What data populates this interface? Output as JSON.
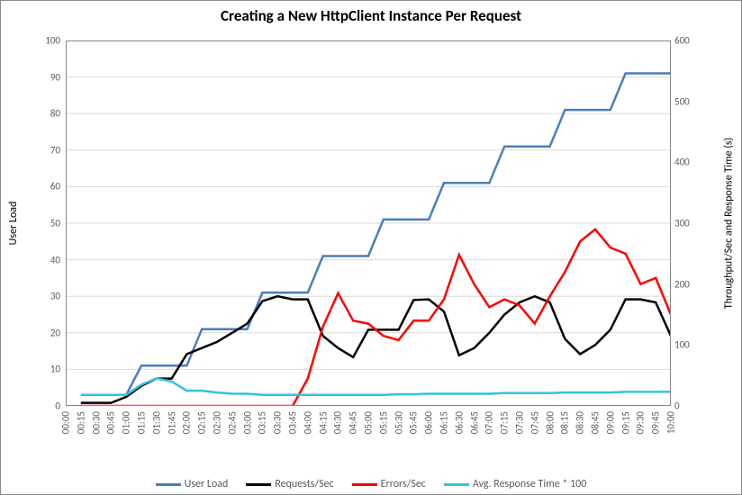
{
  "chart_data": {
    "type": "line",
    "title": "Creating a New HttpClient Instance Per Request",
    "x_categories": [
      "00:00",
      "00:15",
      "00:30",
      "00:45",
      "01:00",
      "01:15",
      "01:30",
      "01:45",
      "02:00",
      "02:15",
      "02:30",
      "02:45",
      "03:00",
      "03:15",
      "03:30",
      "03:45",
      "04:00",
      "04:15",
      "04:30",
      "04:45",
      "05:00",
      "05:15",
      "05:30",
      "05:45",
      "06:00",
      "06:15",
      "06:30",
      "06:45",
      "07:00",
      "07:15",
      "07:30",
      "07:45",
      "08:00",
      "08:15",
      "08:30",
      "08:45",
      "09:00",
      "09:15",
      "09:30",
      "09:45",
      "10:00"
    ],
    "y1": {
      "label": "User Load",
      "min": 0,
      "max": 100,
      "ticks": [
        0,
        10,
        20,
        30,
        40,
        50,
        60,
        70,
        80,
        90,
        100
      ]
    },
    "y2": {
      "label": "Throughput/Sec and Response Time (s)",
      "min": 0,
      "max": 600,
      "ticks": [
        0,
        100,
        200,
        300,
        400,
        500,
        600
      ]
    },
    "series": [
      {
        "name": "User  Load",
        "color": "#4a7ebb",
        "axis": "y1",
        "values": [
          null,
          3,
          3,
          3,
          3,
          11,
          11,
          11,
          11,
          21,
          21,
          21,
          21,
          31,
          31,
          31,
          31,
          41,
          41,
          41,
          41,
          51,
          51,
          51,
          51,
          61,
          61,
          61,
          61,
          71,
          71,
          71,
          71,
          81,
          81,
          81,
          81,
          91,
          91,
          91,
          91
        ]
      },
      {
        "name": "Requests/Sec",
        "color": "#000000",
        "axis": "y2",
        "values": [
          null,
          5,
          5,
          5,
          15,
          33,
          45,
          45,
          85,
          95,
          105,
          120,
          135,
          172,
          180,
          175,
          175,
          115,
          95,
          80,
          125,
          125,
          125,
          174,
          175,
          155,
          83,
          95,
          120,
          150,
          170,
          180,
          170,
          110,
          85,
          100,
          125,
          175,
          175,
          170,
          115
        ]
      },
      {
        "name": "Errors/Sec",
        "color": "#ff0000",
        "axis": "y2",
        "values": [
          null,
          0,
          0,
          0,
          0,
          0,
          0,
          0,
          0,
          0,
          0,
          0,
          0,
          0,
          0,
          0,
          45,
          130,
          185,
          140,
          135,
          115,
          108,
          140,
          140,
          175,
          248,
          200,
          162,
          175,
          165,
          135,
          180,
          220,
          270,
          290,
          260,
          250,
          200,
          210,
          150
        ]
      },
      {
        "name": "Avg. Response Time * 100",
        "color": "#33c2e0",
        "axis": "y2",
        "values": [
          null,
          18,
          18,
          18,
          18,
          35,
          45,
          40,
          25,
          25,
          22,
          20,
          20,
          18,
          18,
          18,
          18,
          18,
          18,
          18,
          18,
          18,
          19,
          19,
          20,
          20,
          20,
          20,
          20,
          21,
          21,
          21,
          21,
          22,
          22,
          22,
          22,
          23,
          23,
          23,
          23
        ]
      }
    ],
    "legend_position": "bottom",
    "grid": true
  }
}
